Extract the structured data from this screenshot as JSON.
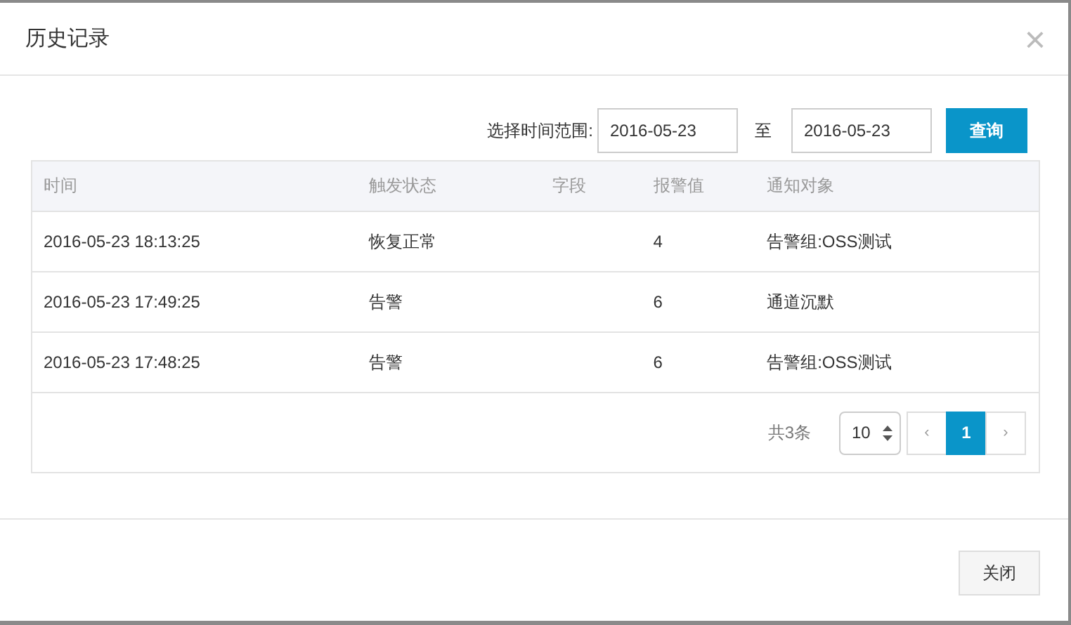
{
  "dialog": {
    "title": "历史记录",
    "close": "×"
  },
  "filter": {
    "label": "选择时间范围:",
    "start": "2016-05-23",
    "separator": "至",
    "end": "2016-05-23",
    "button": "查询"
  },
  "table": {
    "columns": [
      "时间",
      "触发状态",
      "字段",
      "报警值",
      "通知对象"
    ],
    "rows": [
      [
        "2016-05-23 18:13:25",
        "恢复正常",
        "",
        "4",
        "告警组:OSS测试"
      ],
      [
        "2016-05-23 17:49:25",
        "告警",
        "",
        "6",
        "通道沉默"
      ],
      [
        "2016-05-23 17:48:25",
        "告警",
        "",
        "6",
        "告警组:OSS测试"
      ]
    ]
  },
  "pagination": {
    "total": "共3条",
    "page_size": "10",
    "prev": "‹",
    "next": "›",
    "pages": [
      {
        "label": "1",
        "selected": true
      }
    ]
  },
  "footer": {
    "button": "关闭"
  }
}
